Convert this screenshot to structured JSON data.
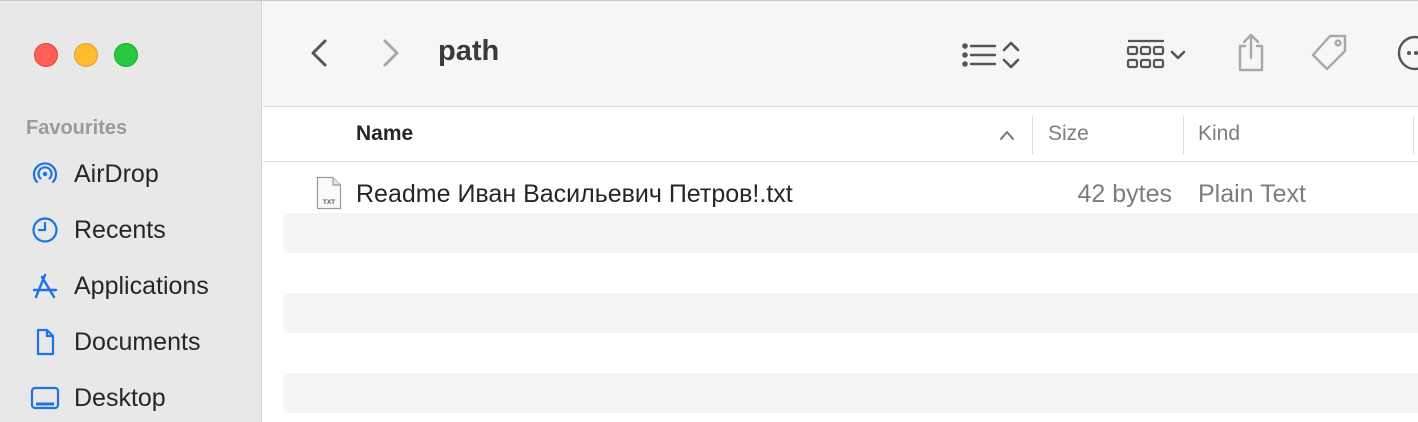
{
  "toolbar": {
    "title": "path"
  },
  "sidebar": {
    "heading": "Favourites",
    "items": [
      {
        "label": "AirDrop",
        "icon": "airdrop-icon"
      },
      {
        "label": "Recents",
        "icon": "clock-icon"
      },
      {
        "label": "Applications",
        "icon": "applications-icon"
      },
      {
        "label": "Documents",
        "icon": "document-icon"
      },
      {
        "label": "Desktop",
        "icon": "desktop-icon"
      }
    ]
  },
  "columns": {
    "name": "Name",
    "size": "Size",
    "kind": "Kind"
  },
  "files": [
    {
      "name": "Readme Иван Васильевич Петров!.txt",
      "size": "42 bytes",
      "kind": "Plain Text",
      "icon_label": "TXT"
    }
  ],
  "colors": {
    "accent": "#1a73e8",
    "close": "#fe5f57",
    "minimize": "#febc2e",
    "zoom": "#28c840"
  }
}
